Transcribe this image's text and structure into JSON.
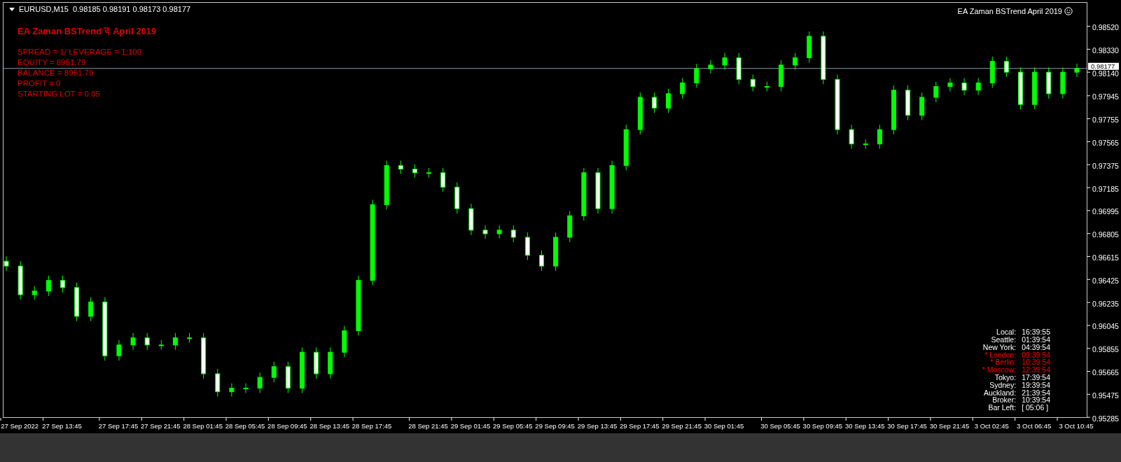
{
  "chart_header": {
    "symbol": "EURUSD,M15",
    "quotes": "0.98185 0.98191 0.98173 0.98177"
  },
  "ea_panel": {
    "title": "EA Zaman BSTrend",
    "title_suffix": "April 2019",
    "lines": [
      "SPREAD = 1/ LEVERAGE = 1:100",
      "EQUITY = 8951.79",
      "BALANCE = 8951.79",
      "PROFIT = 0",
      "STARTING LOT = 0.05"
    ]
  },
  "ea_label": "EA Zaman BSTrend April 2019",
  "clock": [
    {
      "city": "Local:",
      "time": "16:39:55",
      "highlighted": false
    },
    {
      "city": "Seattle:",
      "time": "01:39:54",
      "highlighted": false
    },
    {
      "city": "New York:",
      "time": "04:39:54",
      "highlighted": false
    },
    {
      "city": "* London:",
      "time": "09:39:54",
      "highlighted": true
    },
    {
      "city": "* Berlin:",
      "time": "10:39:54",
      "highlighted": true
    },
    {
      "city": "* Moscow:",
      "time": "12:39:54",
      "highlighted": true
    },
    {
      "city": "Tokyo:",
      "time": "17:39:54",
      "highlighted": false
    },
    {
      "city": "Sydney:",
      "time": "19:39:54",
      "highlighted": false
    },
    {
      "city": "Auckland:",
      "time": "21:39:54",
      "highlighted": false
    },
    {
      "city": "Broker:",
      "time": "10:39:54",
      "highlighted": false
    },
    {
      "city": "Bar Left:",
      "time": "[ 05:06 ]",
      "highlighted": false
    }
  ],
  "chart_data": {
    "type": "candlestick",
    "ref_lines": [
      {
        "axis": "y",
        "value": 0.98177,
        "label": "0.98177",
        "color": "#8a9aa8"
      }
    ],
    "ylim": [
      0.9528,
      0.9872
    ],
    "categories": [
      null,
      "27 Sep 2022",
      null,
      null,
      "27 Sep 13:45",
      null,
      null,
      null,
      "27 Sep 17:45",
      null,
      null,
      "27 Sep 21:45",
      null,
      null,
      "28 Sep 01:45",
      null,
      null,
      "28 Sep 05:45",
      null,
      null,
      "28 Sep 09:45",
      null,
      null,
      "28 Sep 13:45",
      null,
      null,
      "28 Sep 17:45",
      null,
      null,
      null,
      "28 Sep 21:45",
      null,
      null,
      "29 Sep 01:45",
      null,
      null,
      "29 Sep 05:45",
      null,
      null,
      "29 Sep 09:45",
      null,
      null,
      "29 Sep 13:45",
      null,
      null,
      "29 Sep 17:45",
      null,
      null,
      "29 Sep 21:45",
      null,
      null,
      "30 Sep 01:45",
      null,
      null,
      null,
      "30 Sep 05:45",
      null,
      null,
      "30 Sep 09:45",
      null,
      null,
      "30 Sep 13:45",
      null,
      null,
      "30 Sep 17:45",
      null,
      null,
      "30 Sep 21:45",
      null,
      null,
      "3 Oct 02:45",
      null,
      null,
      "3 Oct 06:45",
      null,
      null,
      "3 Oct 10:45"
    ],
    "ohlc": [
      [
        0.96582,
        0.96622,
        0.96502,
        0.96542
      ],
      [
        0.96542,
        0.96582,
        0.96265,
        0.96305
      ],
      [
        0.96305,
        0.96375,
        0.96265,
        0.96335
      ],
      [
        0.96335,
        0.96463,
        0.96295,
        0.96423
      ],
      [
        0.96423,
        0.96463,
        0.96324,
        0.96364
      ],
      [
        0.96364,
        0.96404,
        0.96086,
        0.96126
      ],
      [
        0.96126,
        0.96285,
        0.96086,
        0.96245
      ],
      [
        0.96245,
        0.96285,
        0.9576,
        0.958
      ],
      [
        0.958,
        0.95929,
        0.9576,
        0.95889
      ],
      [
        0.95889,
        0.95988,
        0.95849,
        0.95948
      ],
      [
        0.95948,
        0.95988,
        0.95849,
        0.95889
      ],
      [
        0.95889,
        0.95929,
        0.95849,
        0.95889
      ],
      [
        0.95889,
        0.95988,
        0.95849,
        0.95948
      ],
      [
        0.95948,
        0.95988,
        0.95908,
        0.95948
      ],
      [
        0.95948,
        0.95988,
        0.95611,
        0.95651
      ],
      [
        0.95651,
        0.95691,
        0.95462,
        0.95502
      ],
      [
        0.95502,
        0.95572,
        0.95462,
        0.95532
      ],
      [
        0.95532,
        0.95572,
        0.95492,
        0.95532
      ],
      [
        0.95532,
        0.95661,
        0.95492,
        0.95621
      ],
      [
        0.95621,
        0.9575,
        0.95581,
        0.9571
      ],
      [
        0.9571,
        0.9575,
        0.95492,
        0.95532
      ],
      [
        0.95532,
        0.95869,
        0.95492,
        0.95829
      ],
      [
        0.95829,
        0.95869,
        0.95611,
        0.95651
      ],
      [
        0.95651,
        0.95869,
        0.95611,
        0.95829
      ],
      [
        0.95829,
        0.96047,
        0.95789,
        0.96007
      ],
      [
        0.96007,
        0.96463,
        0.95967,
        0.96423
      ],
      [
        0.96423,
        0.9709,
        0.96383,
        0.9705
      ],
      [
        0.9705,
        0.97414,
        0.9701,
        0.97374
      ],
      [
        0.97374,
        0.97414,
        0.97304,
        0.97344
      ],
      [
        0.97344,
        0.97384,
        0.97274,
        0.97314
      ],
      [
        0.97314,
        0.97354,
        0.97274,
        0.97314
      ],
      [
        0.97314,
        0.97354,
        0.97155,
        0.97195
      ],
      [
        0.97195,
        0.97235,
        0.96977,
        0.97017
      ],
      [
        0.97017,
        0.97057,
        0.96799,
        0.96839
      ],
      [
        0.96839,
        0.96879,
        0.96769,
        0.96809
      ],
      [
        0.96809,
        0.96879,
        0.96769,
        0.96839
      ],
      [
        0.96839,
        0.96879,
        0.9674,
        0.9678
      ],
      [
        0.9678,
        0.9682,
        0.96591,
        0.96631
      ],
      [
        0.96631,
        0.96671,
        0.96502,
        0.96542
      ],
      [
        0.96542,
        0.9682,
        0.96502,
        0.9678
      ],
      [
        0.9678,
        0.96998,
        0.9674,
        0.96958
      ],
      [
        0.96958,
        0.97354,
        0.96918,
        0.97314
      ],
      [
        0.97314,
        0.97354,
        0.96977,
        0.97017
      ],
      [
        0.97017,
        0.97414,
        0.96977,
        0.97374
      ],
      [
        0.97374,
        0.97711,
        0.97334,
        0.97671
      ],
      [
        0.97671,
        0.97978,
        0.97631,
        0.97938
      ],
      [
        0.97938,
        0.97978,
        0.97809,
        0.97849
      ],
      [
        0.97849,
        0.98008,
        0.97809,
        0.97968
      ],
      [
        0.97968,
        0.98097,
        0.97928,
        0.98057
      ],
      [
        0.98057,
        0.98215,
        0.98017,
        0.98175
      ],
      [
        0.98175,
        0.98245,
        0.98135,
        0.98205
      ],
      [
        0.98205,
        0.98305,
        0.98165,
        0.98265
      ],
      [
        0.98265,
        0.98305,
        0.98046,
        0.98086
      ],
      [
        0.98086,
        0.98126,
        0.97987,
        0.98027
      ],
      [
        0.98027,
        0.98067,
        0.97987,
        0.98027
      ],
      [
        0.98027,
        0.98245,
        0.97987,
        0.98205
      ],
      [
        0.98205,
        0.98305,
        0.98165,
        0.98265
      ],
      [
        0.98265,
        0.98483,
        0.98225,
        0.98443
      ],
      [
        0.98443,
        0.98483,
        0.98046,
        0.98086
      ],
      [
        0.98086,
        0.98126,
        0.97631,
        0.97671
      ],
      [
        0.97671,
        0.97711,
        0.97512,
        0.97552
      ],
      [
        0.97552,
        0.97592,
        0.97512,
        0.97552
      ],
      [
        0.97552,
        0.97711,
        0.97512,
        0.97671
      ],
      [
        0.97671,
        0.98037,
        0.97631,
        0.97997
      ],
      [
        0.97997,
        0.98037,
        0.97749,
        0.97789
      ],
      [
        0.97789,
        0.97978,
        0.97749,
        0.97938
      ],
      [
        0.97938,
        0.98067,
        0.97898,
        0.98027
      ],
      [
        0.98027,
        0.98097,
        0.97987,
        0.98057
      ],
      [
        0.98057,
        0.98097,
        0.97957,
        0.97997
      ],
      [
        0.97997,
        0.98097,
        0.97957,
        0.98057
      ],
      [
        0.98057,
        0.98275,
        0.98017,
        0.98235
      ],
      [
        0.98235,
        0.98275,
        0.98106,
        0.98146
      ],
      [
        0.98146,
        0.98186,
        0.97839,
        0.97879
      ],
      [
        0.97879,
        0.98186,
        0.97839,
        0.98146
      ],
      [
        0.98146,
        0.98186,
        0.97928,
        0.97968
      ],
      [
        0.97968,
        0.98186,
        0.97928,
        0.98146
      ],
      [
        0.98146,
        0.98217,
        0.98106,
        0.98177
      ]
    ],
    "yticks": [
      {
        "value": 0.9852,
        "label": "0.98520"
      },
      {
        "value": 0.9833,
        "label": "0.98330"
      },
      {
        "value": 0.9814,
        "label": "0.98140"
      },
      {
        "value": 0.97945,
        "label": "0.97945"
      },
      {
        "value": 0.97755,
        "label": "0.97755"
      },
      {
        "value": 0.97565,
        "label": "0.97565"
      },
      {
        "value": 0.97375,
        "label": "0.97375"
      },
      {
        "value": 0.97185,
        "label": "0.97185"
      },
      {
        "value": 0.96995,
        "label": "0.96995"
      },
      {
        "value": 0.96805,
        "label": "0.96805"
      },
      {
        "value": 0.96615,
        "label": "0.96615"
      },
      {
        "value": 0.96425,
        "label": "0.96425"
      },
      {
        "value": 0.96235,
        "label": "0.96235"
      },
      {
        "value": 0.96045,
        "label": "0.96045"
      },
      {
        "value": 0.95855,
        "label": "0.95855"
      },
      {
        "value": 0.95665,
        "label": "0.95665"
      },
      {
        "value": 0.95475,
        "label": "0.95475"
      },
      {
        "value": 0.95285,
        "label": "0.95285"
      }
    ]
  }
}
